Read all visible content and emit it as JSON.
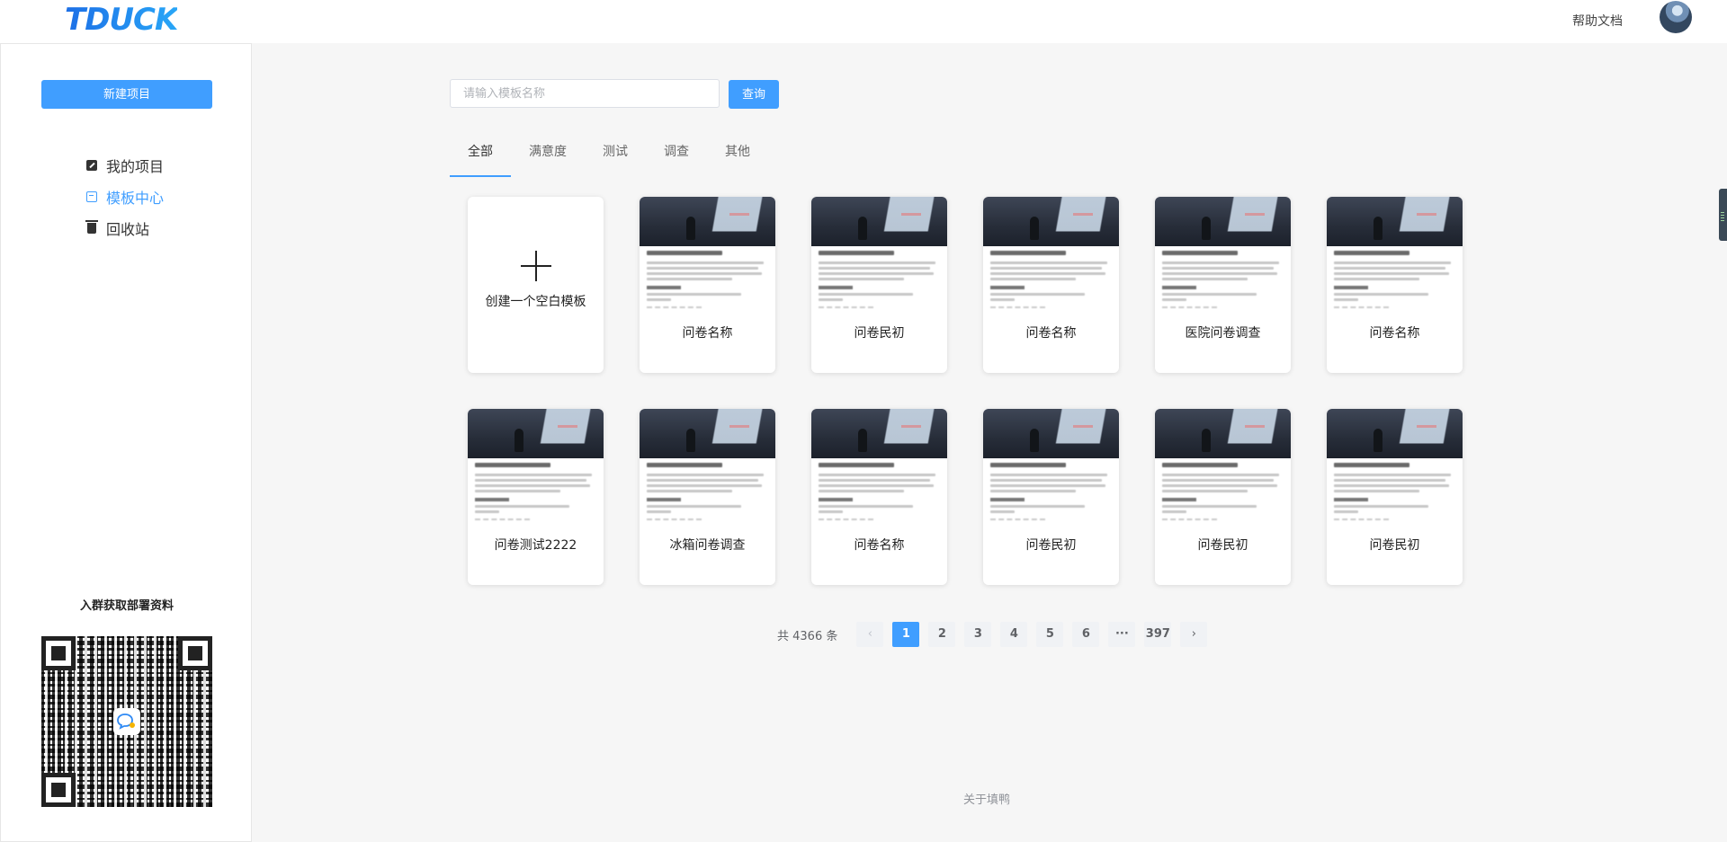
{
  "header": {
    "logo": "TDUCK",
    "help_link": "帮助文档"
  },
  "sidebar": {
    "new_project_label": "新建项目",
    "items": [
      {
        "label": "我的项目",
        "icon": "edit-icon"
      },
      {
        "label": "模板中心",
        "icon": "template-icon",
        "active": true
      },
      {
        "label": "回收站",
        "icon": "trash-icon"
      }
    ],
    "qr_title": "入群获取部署资料"
  },
  "search": {
    "placeholder": "请输入模板名称",
    "value": "",
    "button_label": "查询"
  },
  "tabs": [
    {
      "label": "全部",
      "active": true
    },
    {
      "label": "满意度"
    },
    {
      "label": "测试"
    },
    {
      "label": "调查"
    },
    {
      "label": "其他"
    }
  ],
  "blank_card": {
    "label": "创建一个空白模板"
  },
  "templates": [
    {
      "name": "问卷名称"
    },
    {
      "name": "问卷民初"
    },
    {
      "name": "问卷名称"
    },
    {
      "name": "医院问卷调查"
    },
    {
      "name": "问卷名称"
    },
    {
      "name": "问卷测试2222"
    },
    {
      "name": "冰箱问卷调查"
    },
    {
      "name": "问卷名称"
    },
    {
      "name": "问卷民初"
    },
    {
      "name": "问卷民初"
    },
    {
      "name": "问卷民初"
    }
  ],
  "pagination": {
    "total_label": "共 4366 条",
    "prev": "‹",
    "next": "›",
    "pages": [
      "1",
      "2",
      "3",
      "4",
      "5",
      "6",
      "···",
      "397"
    ],
    "current": "1"
  },
  "footer": {
    "about": "关于填鸭"
  },
  "colors": {
    "primary": "#409eff",
    "background": "#f6f6f6",
    "logo": "#2f8af5"
  }
}
